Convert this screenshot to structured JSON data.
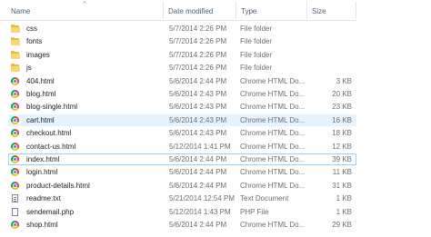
{
  "columns": {
    "name": "Name",
    "date": "Date modified",
    "type": "Type",
    "size": "Size"
  },
  "sort_indicator": "^",
  "icons": {
    "folder": "folder-icon",
    "chrome_html": "chrome-html-icon",
    "text": "text-document-icon",
    "php": "php-file-icon"
  },
  "colors": {
    "folder": "#f8d775",
    "hover_row": "#e5f3ff",
    "selected_border": "#99d1ff",
    "header_text": "#4c607a"
  },
  "files": [
    {
      "name": "css",
      "date": "5/7/2014 2:26 PM",
      "type": "File folder",
      "size": "",
      "icon": "folder"
    },
    {
      "name": "fonts",
      "date": "5/7/2014 2:26 PM",
      "type": "File folder",
      "size": "",
      "icon": "folder"
    },
    {
      "name": "images",
      "date": "5/7/2014 2:26 PM",
      "type": "File folder",
      "size": "",
      "icon": "folder"
    },
    {
      "name": "js",
      "date": "5/7/2014 2:26 PM",
      "type": "File folder",
      "size": "",
      "icon": "folder"
    },
    {
      "name": "404.html",
      "date": "5/6/2014 2:44 PM",
      "type": "Chrome HTML Do...",
      "size": "3 KB",
      "icon": "chrome_html"
    },
    {
      "name": "blog.html",
      "date": "5/6/2014 2:43 PM",
      "type": "Chrome HTML Do...",
      "size": "20 KB",
      "icon": "chrome_html"
    },
    {
      "name": "blog-single.html",
      "date": "5/6/2014 2:43 PM",
      "type": "Chrome HTML Do...",
      "size": "23 KB",
      "icon": "chrome_html"
    },
    {
      "name": "cart.html",
      "date": "5/6/2014 2:43 PM",
      "type": "Chrome HTML Do...",
      "size": "16 KB",
      "icon": "chrome_html",
      "state": "hovered"
    },
    {
      "name": "checkout.html",
      "date": "5/6/2014 2:43 PM",
      "type": "Chrome HTML Do...",
      "size": "18 KB",
      "icon": "chrome_html"
    },
    {
      "name": "contact-us.html",
      "date": "5/12/2014 1:41 PM",
      "type": "Chrome HTML Do...",
      "size": "12 KB",
      "icon": "chrome_html"
    },
    {
      "name": "index.html",
      "date": "5/6/2014 2:44 PM",
      "type": "Chrome HTML Do...",
      "size": "39 KB",
      "icon": "chrome_html",
      "state": "selected"
    },
    {
      "name": "login.html",
      "date": "5/6/2014 2:44 PM",
      "type": "Chrome HTML Do...",
      "size": "11 KB",
      "icon": "chrome_html"
    },
    {
      "name": "product-details.html",
      "date": "5/6/2014 2:44 PM",
      "type": "Chrome HTML Do...",
      "size": "31 KB",
      "icon": "chrome_html"
    },
    {
      "name": "readme.txt",
      "date": "5/21/2014 12:54 PM",
      "type": "Text Document",
      "size": "1 KB",
      "icon": "text"
    },
    {
      "name": "sendemail.php",
      "date": "5/12/2014 1:43 PM",
      "type": "PHP File",
      "size": "1 KB",
      "icon": "php"
    },
    {
      "name": "shop.html",
      "date": "5/6/2014 2:44 PM",
      "type": "Chrome HTML Do...",
      "size": "29 KB",
      "icon": "chrome_html"
    }
  ]
}
